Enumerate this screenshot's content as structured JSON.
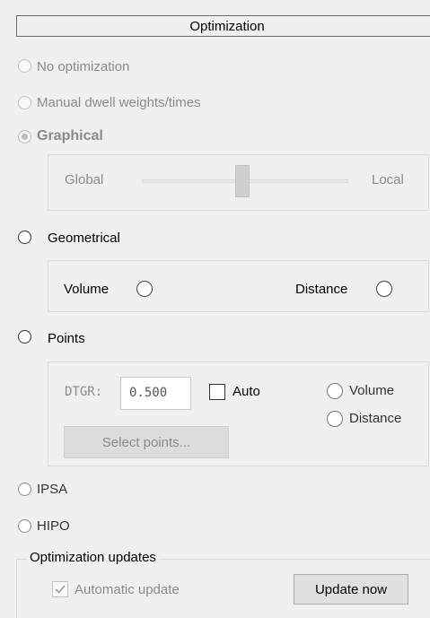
{
  "header": {
    "title": "Optimization"
  },
  "methods": {
    "no_optimization": "No optimization",
    "manual": "Manual dwell weights/times",
    "graphical": "Graphical",
    "geometrical": "Geometrical",
    "points": "Points",
    "ipsa": "IPSA",
    "hipo": "HIPO",
    "selected": "Graphical"
  },
  "graphical_panel": {
    "left_label": "Global",
    "right_label": "Local",
    "slider_level_percent": 50
  },
  "geometrical_panel": {
    "volume_label": "Volume",
    "distance_label": "Distance"
  },
  "points_panel": {
    "dtgr_label": "DTGR:",
    "dtgr_value": "0.500",
    "auto_label": "Auto",
    "volume_label": "Volume",
    "distance_label": "Distance",
    "select_points_label": "Select points..."
  },
  "updates": {
    "legend": "Optimization updates",
    "automatic_update_label": "Automatic update",
    "automatic_update_checked": true,
    "update_now_label": "Update now"
  },
  "colors": {
    "background": "#f0f0f0",
    "disabled_text": "#8a8a8a"
  }
}
